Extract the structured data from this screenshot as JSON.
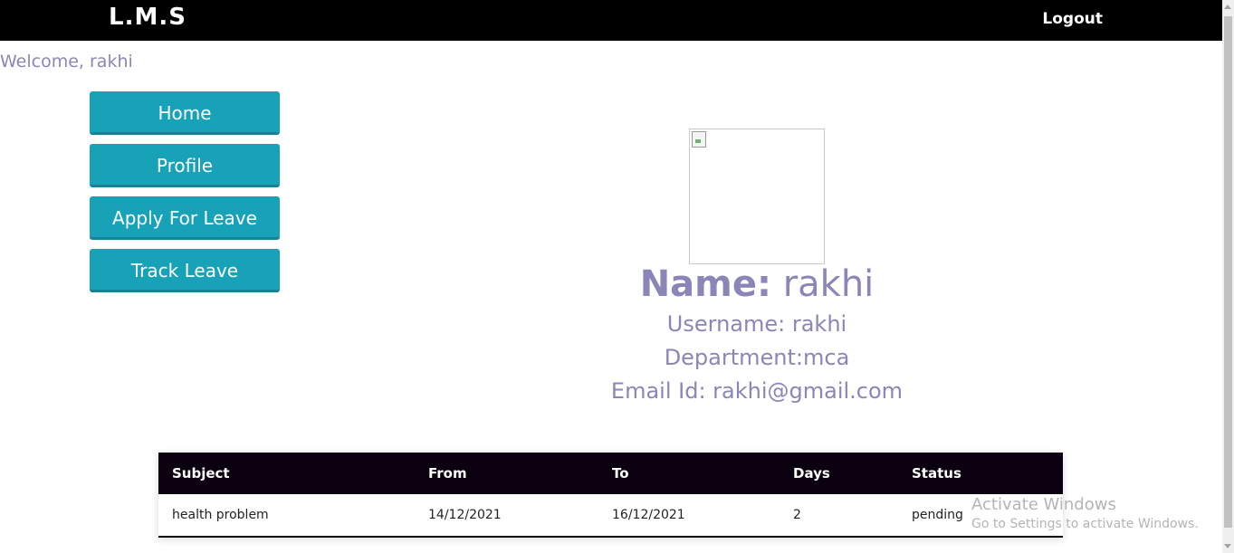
{
  "navbar": {
    "brand": "L.M.S",
    "logout_label": "Logout"
  },
  "welcome_text": "Welcome, rakhi",
  "sidebar": {
    "items": [
      {
        "label": "Home"
      },
      {
        "label": "Profile"
      },
      {
        "label": "Apply For Leave"
      },
      {
        "label": "Track Leave"
      }
    ]
  },
  "profile": {
    "name_label": "Name:",
    "name_value": " rakhi",
    "username_line": "Username: rakhi",
    "department_line": "Department:mca",
    "email_line": "Email Id: rakhi@gmail.com"
  },
  "leave_table": {
    "headers": [
      "Subject",
      "From",
      "To",
      "Days",
      "Status"
    ],
    "rows": [
      [
        "health problem",
        "14/12/2021",
        "16/12/2021",
        "2",
        "pending"
      ]
    ]
  },
  "watermark": {
    "title": "Activate Windows",
    "subtitle": "Go to Settings to activate Windows."
  },
  "colors": {
    "navbar": "#000000",
    "sidebar_button": "#17a2b8",
    "profile_text": "#8a86b8",
    "table_header": "#0b0010"
  }
}
